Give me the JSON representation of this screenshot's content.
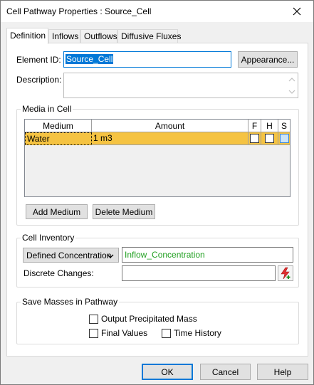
{
  "window": {
    "title": "Cell Pathway Properties : Source_Cell"
  },
  "tabs": [
    {
      "label": "Definition"
    },
    {
      "label": "Inflows"
    },
    {
      "label": "Outflows"
    },
    {
      "label": "Diffusive Fluxes"
    }
  ],
  "definition": {
    "element_id_label": "Element ID:",
    "element_id_value": "Source_Cell",
    "appearance_button": "Appearance...",
    "description_label": "Description:",
    "description_value": ""
  },
  "media": {
    "group_title": "Media in Cell",
    "columns": [
      "Medium",
      "Amount",
      "F",
      "H",
      "S"
    ],
    "rows": [
      {
        "medium": "Water",
        "amount": "1 m3",
        "f": false,
        "h": false,
        "s": false
      }
    ],
    "add_button": "Add Medium",
    "delete_button": "Delete Medium",
    "row_highlight_color": "#f5c342"
  },
  "inventory": {
    "group_title": "Cell Inventory",
    "mode_selected": "Defined Concentration",
    "mode_value": "Inflow_Concentration",
    "mode_value_color": "#22a022",
    "discrete_label": "Discrete Changes:",
    "discrete_value": ""
  },
  "save_masses": {
    "group_title": "Save Masses in Pathway",
    "output_precipitated": "Output Precipitated Mass",
    "final_values": "Final Values",
    "time_history": "Time History"
  },
  "footer": {
    "ok": "OK",
    "cancel": "Cancel",
    "help": "Help"
  },
  "colors": {
    "accent": "#0078d7",
    "selection": "#0078d7"
  }
}
